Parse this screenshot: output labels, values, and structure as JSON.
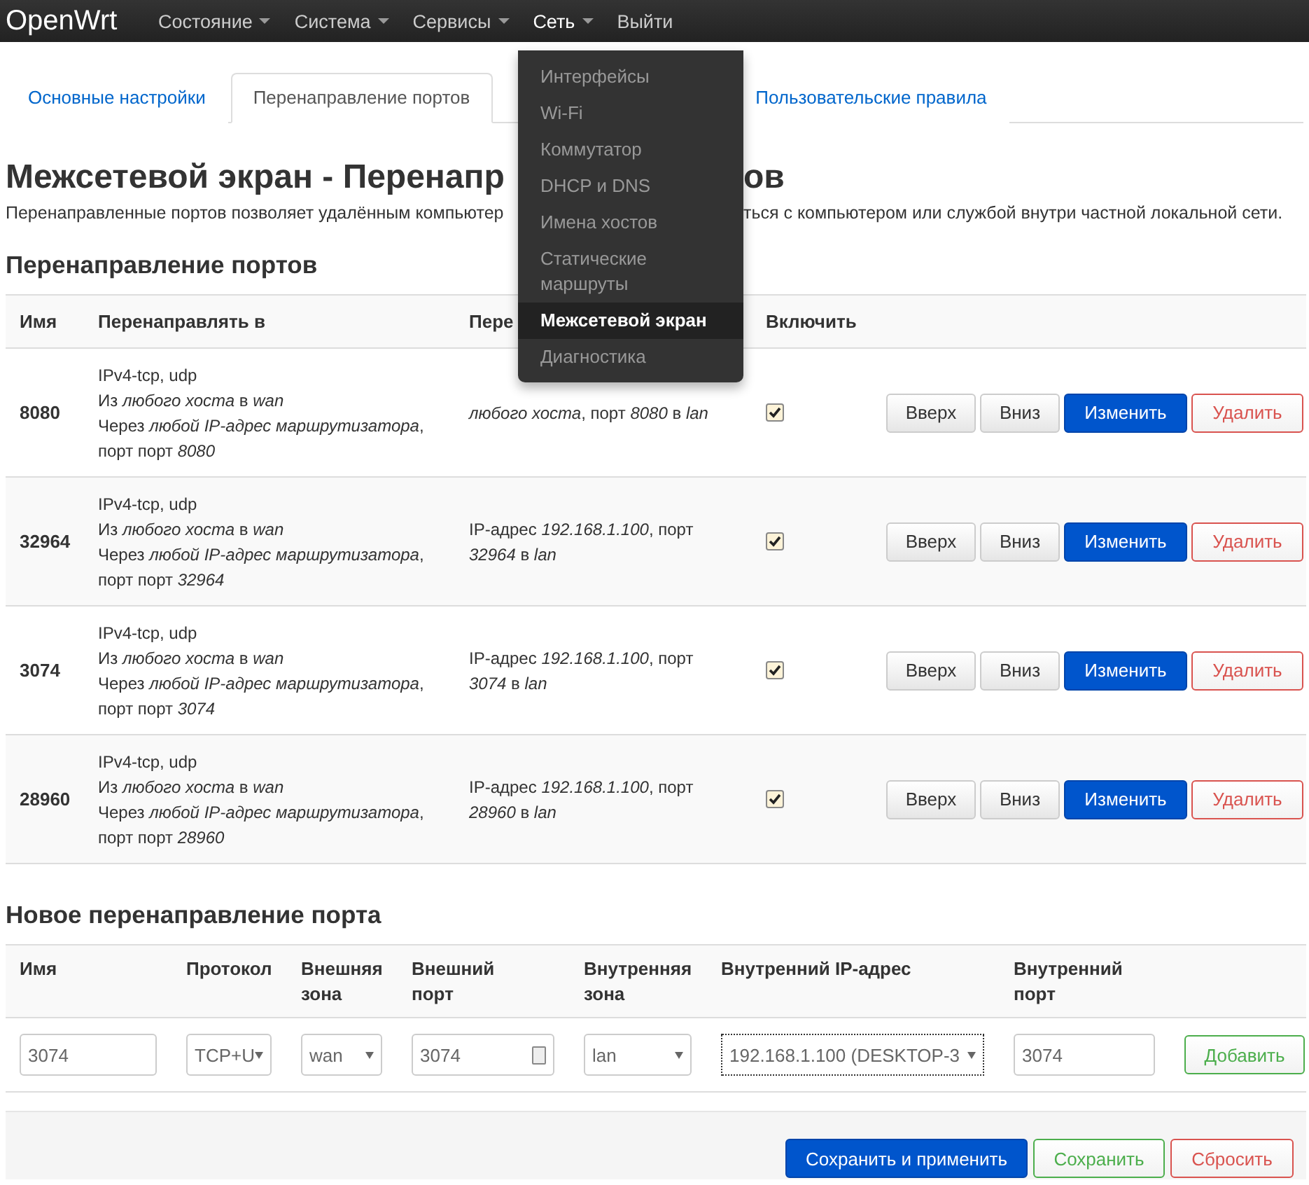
{
  "navbar": {
    "brand": "OpenWrt",
    "items": [
      {
        "label": "Состояние",
        "dropdown": true,
        "open": false
      },
      {
        "label": "Система",
        "dropdown": true,
        "open": false
      },
      {
        "label": "Сервисы",
        "dropdown": true,
        "open": false
      },
      {
        "label": "Сеть",
        "dropdown": true,
        "open": true
      },
      {
        "label": "Выйти",
        "dropdown": false,
        "open": false
      }
    ]
  },
  "network_menu": [
    {
      "label": "Интерфейсы",
      "selected": false
    },
    {
      "label": "Wi-Fi",
      "selected": false
    },
    {
      "label": "Коммутатор",
      "selected": false
    },
    {
      "label": "DHCP и DNS",
      "selected": false
    },
    {
      "label": "Имена хостов",
      "selected": false
    },
    {
      "label": "Статические маршруты",
      "selected": false
    },
    {
      "label": "Межсетевой экран",
      "selected": true
    },
    {
      "label": "Диагностика",
      "selected": false
    }
  ],
  "tabs": [
    {
      "label": "Основные настройки",
      "selected": false
    },
    {
      "label": "Перенаправление портов",
      "selected": true
    },
    {
      "label": "Пользовательские правила",
      "selected": false
    }
  ],
  "title_parts": [
    "Межсетевой экран - Перенапр",
    "ов"
  ],
  "description_parts": [
    "Перенаправленные портов позволяет удалённым компьютер",
    "ться с компьютером или службой внутри частной локальной сети."
  ],
  "section_title": "Перенаправление портов",
  "table": {
    "columns": [
      "Имя",
      "Перенаправлять в",
      "Пере",
      "Включить"
    ],
    "rows": [
      {
        "name": "8080",
        "match": [
          "IPv4-tcp, udp",
          "Из *любого хоста* в *wan*",
          "Через *любой IP-адрес маршрутизатора*,",
          "порт порт *8080*"
        ],
        "forward": [
          "*любого хоста*, порт *8080* в *lan*"
        ],
        "enabled": true,
        "buttons": [
          {
            "label": "Вверх",
            "kind": "plain"
          },
          {
            "label": "Вниз",
            "kind": "plain"
          },
          {
            "label": "Изменить",
            "kind": "primary"
          },
          {
            "label": "Удалить",
            "kind": "danger"
          }
        ]
      },
      {
        "name": "32964",
        "match": [
          "IPv4-tcp, udp",
          "Из *любого хоста* в *wan*",
          "Через *любой IP-адрес маршрутизатора*,",
          "порт порт *32964*"
        ],
        "forward": [
          "IP-адрес *192.168.1.100*, порт",
          "*32964* в *lan*"
        ],
        "enabled": true,
        "buttons": [
          {
            "label": "Вверх",
            "kind": "plain"
          },
          {
            "label": "Вниз",
            "kind": "plain"
          },
          {
            "label": "Изменить",
            "kind": "primary"
          },
          {
            "label": "Удалить",
            "kind": "danger"
          }
        ]
      },
      {
        "name": "3074",
        "match": [
          "IPv4-tcp, udp",
          "Из *любого хоста* в *wan*",
          "Через *любой IP-адрес маршрутизатора*,",
          "порт порт *3074*"
        ],
        "forward": [
          "IP-адрес *192.168.1.100*, порт",
          "*3074* в *lan*"
        ],
        "enabled": true,
        "buttons": [
          {
            "label": "Вверх",
            "kind": "plain"
          },
          {
            "label": "Вниз",
            "kind": "plain"
          },
          {
            "label": "Изменить",
            "kind": "primary"
          },
          {
            "label": "Удалить",
            "kind": "danger"
          }
        ]
      },
      {
        "name": "28960",
        "match": [
          "IPv4-tcp, udp",
          "Из *любого хоста* в *wan*",
          "Через *любой IP-адрес маршрутизатора*,",
          "порт порт *28960*"
        ],
        "forward": [
          "IP-адрес *192.168.1.100*, порт",
          "*28960* в *lan*"
        ],
        "enabled": true,
        "buttons": [
          {
            "label": "Вверх",
            "kind": "plain"
          },
          {
            "label": "Вниз",
            "kind": "plain"
          },
          {
            "label": "Изменить",
            "kind": "primary"
          },
          {
            "label": "Удалить",
            "kind": "danger"
          }
        ]
      }
    ]
  },
  "new_forward": {
    "title": "Новое перенаправление порта",
    "columns": [
      "Имя",
      "Протокол",
      "Внешняя зона",
      "Внешний порт",
      "Внутренняя зона",
      "Внутренний IP-адрес",
      "Внутренний порт"
    ],
    "fields": [
      {
        "kind": "text",
        "value": "3074"
      },
      {
        "kind": "select",
        "value": "TCP+U",
        "focused": false
      },
      {
        "kind": "select",
        "value": "wan",
        "focused": false
      },
      {
        "kind": "number",
        "value": "3074"
      },
      {
        "kind": "select",
        "value": "lan",
        "focused": false
      },
      {
        "kind": "select",
        "value": "192.168.1.100 (DESKTOP-3",
        "focused": true
      },
      {
        "kind": "text",
        "value": "3074"
      }
    ],
    "add_button": "Добавить"
  },
  "footer_buttons": [
    {
      "label": "Сохранить и применить",
      "kind": "primary"
    },
    {
      "label": "Сохранить",
      "kind": "success"
    },
    {
      "label": "Сбросить",
      "kind": "danger"
    }
  ]
}
